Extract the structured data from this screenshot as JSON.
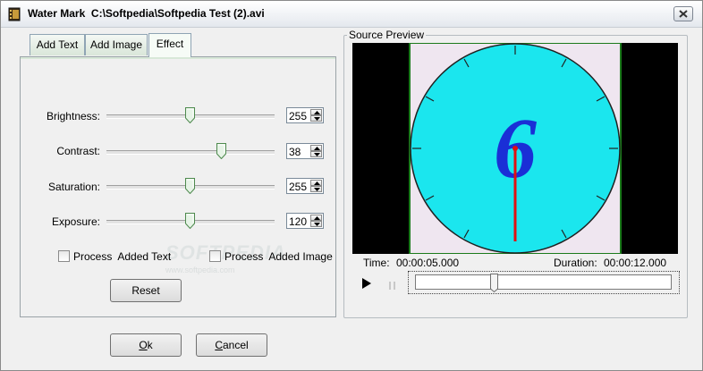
{
  "window": {
    "title_prefix": "Water Mark",
    "file_path": "C:\\Softpedia\\Softpedia Test (2).avi"
  },
  "tabs": [
    {
      "label": "Add Text",
      "active": false
    },
    {
      "label": "Add Image",
      "active": false
    },
    {
      "label": "Effect",
      "active": true
    }
  ],
  "effects": {
    "brightness": {
      "label": "Brightness:",
      "value": "255",
      "level": 0.5
    },
    "contrast": {
      "label": "Contrast:",
      "value": "38",
      "level": 0.68
    },
    "saturation": {
      "label": "Saturation:",
      "value": "255",
      "level": 0.5
    },
    "exposure": {
      "label": "Exposure:",
      "value": "120",
      "level": 0.5
    }
  },
  "checkboxes": {
    "process_text": {
      "label": "Process  Added Text",
      "checked": false
    },
    "process_image": {
      "label": "Process  Added Image",
      "checked": false
    }
  },
  "buttons": {
    "reset": "Reset",
    "ok_accel": "O",
    "ok_rest": "k",
    "cancel_accel": "C",
    "cancel_rest": "ancel"
  },
  "preview": {
    "group_title": "Source Preview",
    "time_label": "Time:",
    "time_value": "00:00:05.000",
    "duration_label": "Duration:",
    "duration_value": "00:00:12.000",
    "seek_position": 0.29,
    "frame_digit": "6"
  },
  "watermark": {
    "text": "SOFTPEDIA",
    "url": "www.softpedia.com"
  },
  "colors": {
    "clock_face": "#1be6ee",
    "frame_bg": "#efe6f0",
    "digit": "#1a2fd6",
    "hand": "#e01010",
    "frame_border": "#1b7a1b"
  },
  "icons": {
    "app": "film-icon",
    "close": "close-icon",
    "play": "play-icon",
    "pause": "pause-icon"
  }
}
